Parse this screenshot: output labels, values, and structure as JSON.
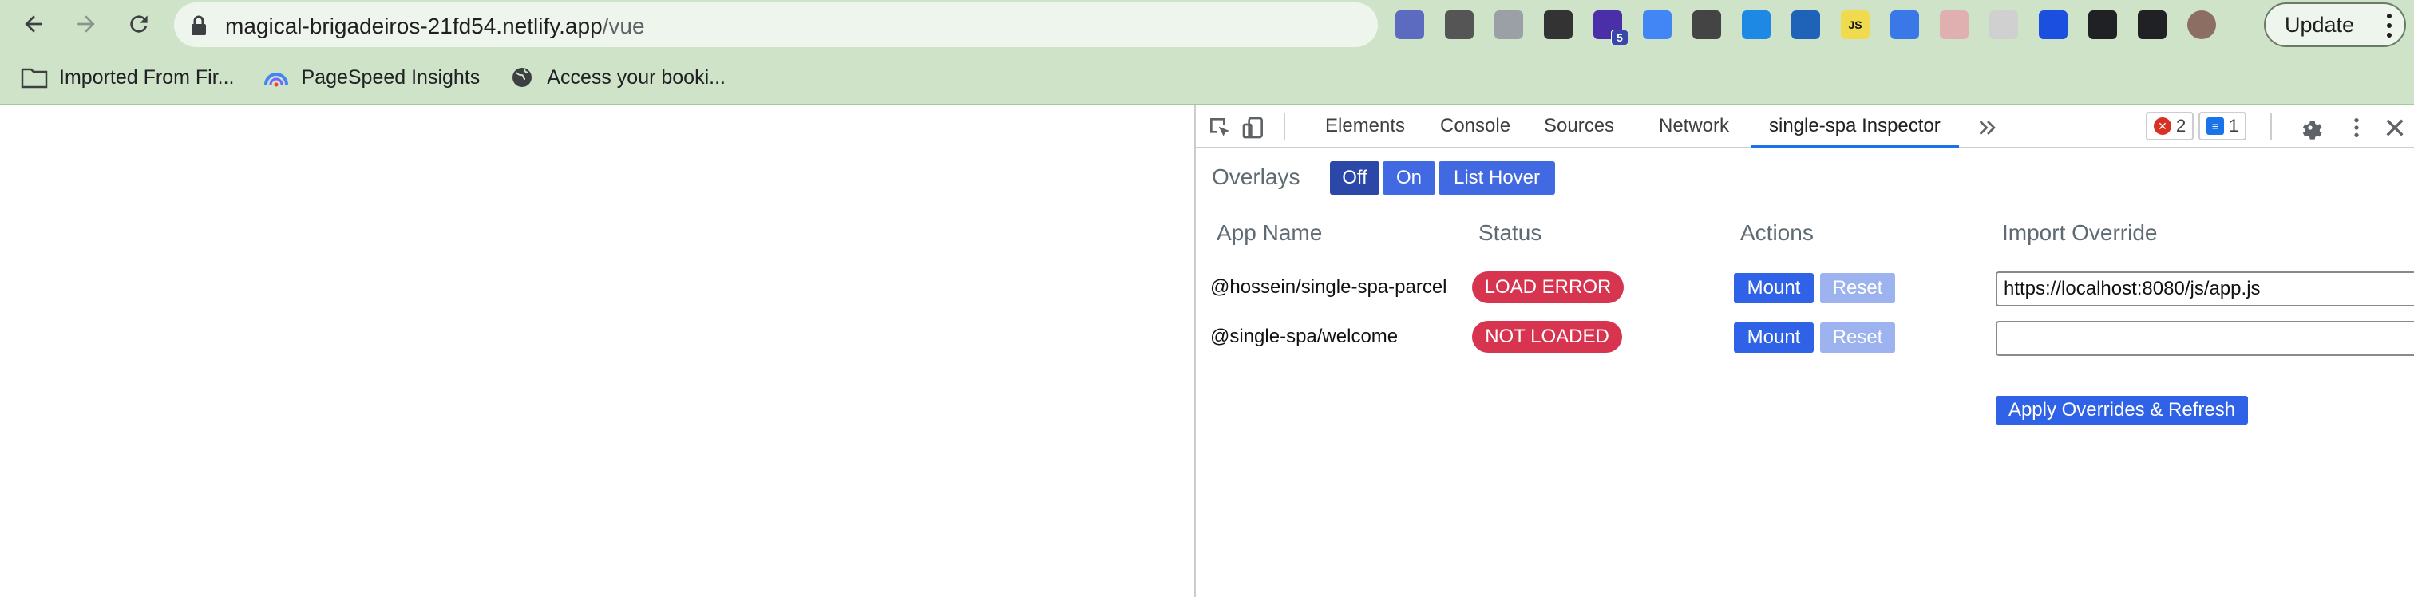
{
  "browser": {
    "url_host": "magical-brigadeiros-21fd54.netlify.app",
    "url_path": "/vue",
    "update_label": "Update",
    "extensions": [
      {
        "name": "bitwarden-icon",
        "color": "#5c6bc0"
      },
      {
        "name": "cookie-icon",
        "color": "#555555"
      },
      {
        "name": "vue-devtools-icon",
        "color": "#9aa0a6"
      },
      {
        "name": "screen-icon",
        "color": "#333333"
      },
      {
        "name": "stack-icon",
        "color": "#4a2fa8",
        "badge": "5"
      },
      {
        "name": "translate-icon",
        "color": "#4285f4"
      },
      {
        "name": "eyedropper-icon",
        "color": "#444444"
      },
      {
        "name": "grid-icon",
        "color": "#1e88e5"
      },
      {
        "name": "wave-icon",
        "color": "#1e63b8"
      },
      {
        "name": "js-icon",
        "color": "#f0db4f",
        "text": "JS"
      },
      {
        "name": "aperture-icon",
        "color": "#3b78e7"
      },
      {
        "name": "ext-k-icon",
        "color": "#e0b0b0"
      },
      {
        "name": "ext-box-icon",
        "color": "#d0d0d0"
      },
      {
        "name": "bolt-icon",
        "color": "#1a4fe0"
      },
      {
        "name": "puzzle-icon",
        "color": "#202124"
      },
      {
        "name": "sidepanel-icon",
        "color": "#202124"
      },
      {
        "name": "profile-avatar-icon",
        "color": "#8d6e63"
      }
    ]
  },
  "bookmarks": [
    {
      "label": "Imported From Fir...",
      "icon": "folder-icon"
    },
    {
      "label": "PageSpeed Insights",
      "icon": "pagespeed-icon"
    },
    {
      "label": "Access your booki...",
      "icon": "globe-icon"
    }
  ],
  "devtools": {
    "tabs": [
      "Elements",
      "Console",
      "Sources",
      "Network",
      "single-spa Inspector"
    ],
    "active_tab": "single-spa Inspector",
    "error_count": "2",
    "message_count": "1"
  },
  "inspector": {
    "overlays_label": "Overlays",
    "overlay_buttons": [
      "Off",
      "On",
      "List Hover"
    ],
    "overlay_selected": "Off",
    "columns": {
      "app_name": "App Name",
      "status": "Status",
      "actions": "Actions",
      "import_override": "Import Override"
    },
    "apps": [
      {
        "name": "@hossein/single-spa-parcel",
        "status": "LOAD ERROR",
        "mount": "Mount",
        "reset": "Reset",
        "override": "https://localhost:8080/js/app.js"
      },
      {
        "name": "@single-spa/welcome",
        "status": "NOT LOADED",
        "mount": "Mount",
        "reset": "Reset",
        "override": ""
      }
    ],
    "apply_label": "Apply Overrides & Refresh",
    "status_color": "#d6344f",
    "accent_color": "#2f62e6"
  }
}
